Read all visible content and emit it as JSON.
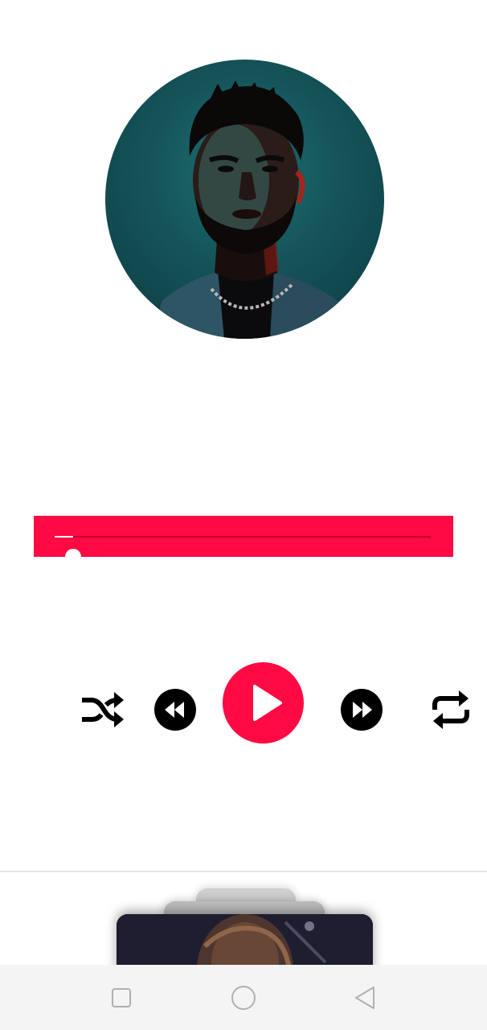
{
  "player": {
    "progress": 0.05,
    "accent_color": "#ff0a43",
    "icons": {
      "shuffle": "shuffle-icon",
      "rewind": "rewind-icon",
      "play": "play-icon",
      "forward": "fast-forward-icon",
      "repeat": "repeat-icon"
    }
  },
  "nav_bar": {
    "icons": [
      "square-recents-icon",
      "circle-home-icon",
      "triangle-back-icon"
    ]
  }
}
